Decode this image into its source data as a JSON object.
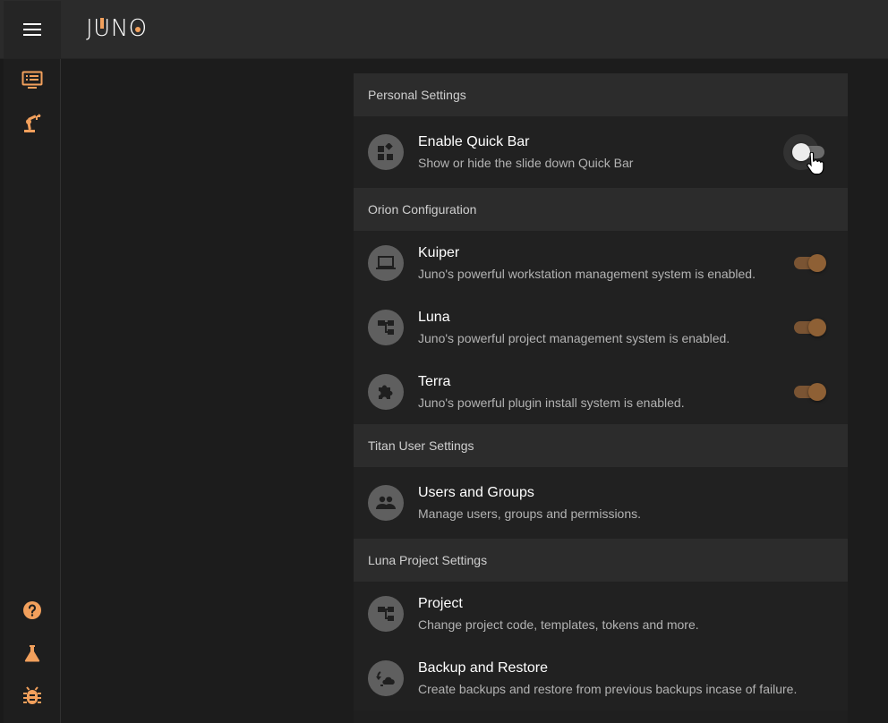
{
  "app": {
    "logo": "JUNO",
    "accent_color": "#f2a05c"
  },
  "sidebar": {
    "top_items": [
      {
        "icon": "dashboard-list-icon"
      },
      {
        "icon": "robot-arm-icon"
      }
    ],
    "bottom_items": [
      {
        "icon": "help-icon"
      },
      {
        "icon": "flask-icon"
      },
      {
        "icon": "bug-icon"
      }
    ]
  },
  "settings": {
    "personal": {
      "header": "Personal Settings",
      "items": [
        {
          "title": "Enable Quick Bar",
          "subtitle": "Show or hide the slide down Quick Bar",
          "icon": "widgets-icon",
          "enabled": false
        }
      ]
    },
    "orion": {
      "header": "Orion Configuration",
      "items": [
        {
          "title": "Kuiper",
          "subtitle": "Juno's powerful workstation management system is enabled.",
          "icon": "laptop-icon",
          "enabled": true
        },
        {
          "title": "Luna",
          "subtitle": "Juno's powerful project management system is enabled.",
          "icon": "account-tree-icon",
          "enabled": true
        },
        {
          "title": "Terra",
          "subtitle": "Juno's powerful plugin install system is enabled.",
          "icon": "puzzle-icon",
          "enabled": true
        }
      ]
    },
    "titan": {
      "header": "Titan User Settings",
      "items": [
        {
          "title": "Users and Groups",
          "subtitle": "Manage users, groups and permissions.",
          "icon": "people-icon"
        }
      ]
    },
    "luna_project": {
      "header": "Luna Project Settings",
      "items": [
        {
          "title": "Project",
          "subtitle": "Change project code, templates, tokens and more.",
          "icon": "account-tree-icon"
        },
        {
          "title": "Backup and Restore",
          "subtitle": "Create backups and restore from previous backups incase of failure.",
          "icon": "cloud-sync-icon"
        }
      ]
    }
  }
}
